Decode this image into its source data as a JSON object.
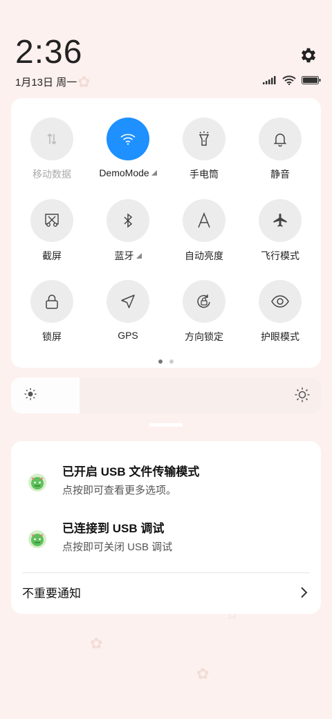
{
  "status_bar": {
    "time": "2:36",
    "date": "1月13日 周一"
  },
  "quick_settings": {
    "tiles": [
      {
        "name": "mobile-data",
        "label": "移动数据",
        "icon": "mobile-data-icon",
        "active": false,
        "disabled": true
      },
      {
        "name": "wifi",
        "label": "DemoMode",
        "icon": "wifi-icon",
        "active": true,
        "expandable": true
      },
      {
        "name": "flashlight",
        "label": "手电筒",
        "icon": "flashlight-icon",
        "active": false
      },
      {
        "name": "mute",
        "label": "静音",
        "icon": "bell-icon",
        "active": false
      },
      {
        "name": "screenshot",
        "label": "截屏",
        "icon": "scissors-icon",
        "active": false
      },
      {
        "name": "bluetooth",
        "label": "蓝牙",
        "icon": "bluetooth-icon",
        "active": false,
        "expandable": true
      },
      {
        "name": "auto-brightness",
        "label": "自动亮度",
        "icon": "letter-a-icon",
        "active": false
      },
      {
        "name": "airplane",
        "label": "飞行模式",
        "icon": "airplane-icon",
        "active": false
      },
      {
        "name": "lock-screen",
        "label": "锁屏",
        "icon": "lock-icon",
        "active": false
      },
      {
        "name": "gps",
        "label": "GPS",
        "icon": "location-arrow-icon",
        "active": false
      },
      {
        "name": "rotation-lock",
        "label": "方向锁定",
        "icon": "rotation-lock-icon",
        "active": false
      },
      {
        "name": "eye-protection",
        "label": "护眼模式",
        "icon": "eye-icon",
        "active": false
      }
    ],
    "page_count": 2,
    "current_page": 1
  },
  "brightness": {
    "level": 0.22
  },
  "notifications": {
    "items": [
      {
        "title": "已开启 USB 文件传输模式",
        "body": "点按即可查看更多选项。",
        "icon": "android-debug-icon"
      },
      {
        "title": "已连接到 USB 调试",
        "body": "点按即可关闭 USB 调试",
        "icon": "android-debug-icon"
      }
    ],
    "footer_label": "不重要通知"
  },
  "colors": {
    "accent": "#1e90ff",
    "background": "#fdf1ef"
  }
}
